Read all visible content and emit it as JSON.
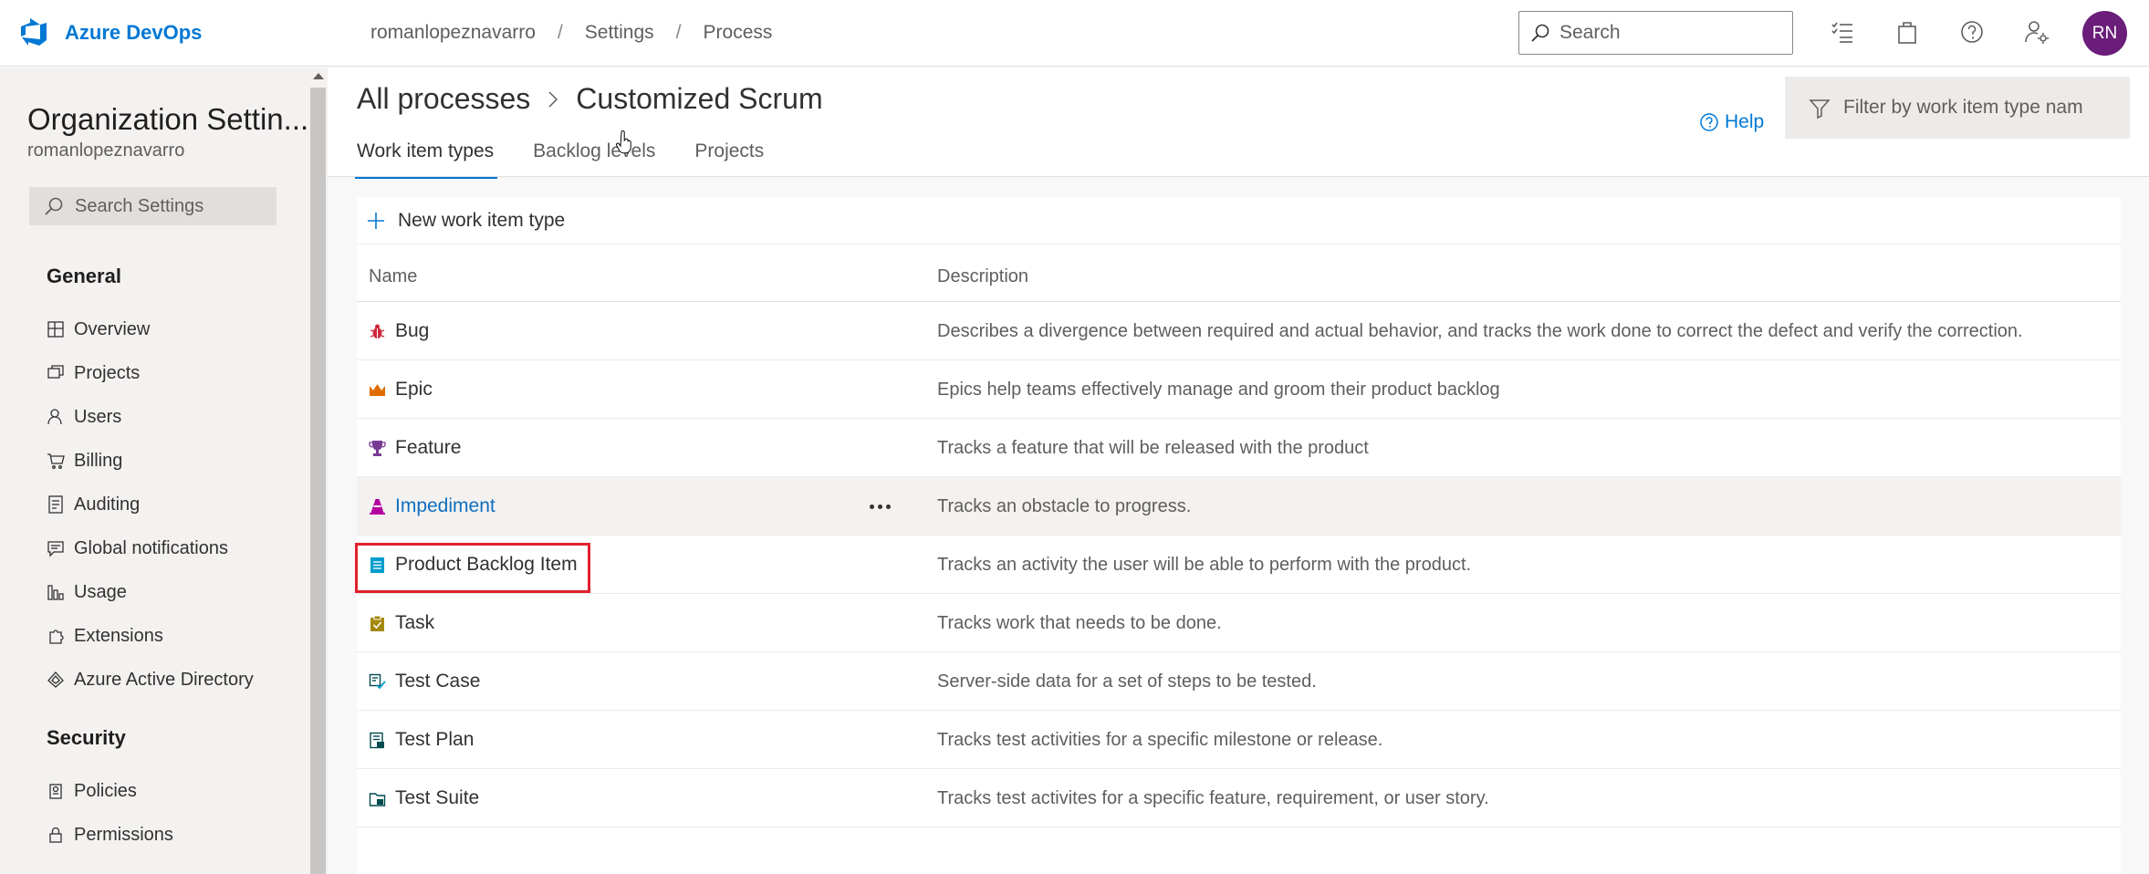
{
  "header": {
    "brand": "Azure DevOps",
    "breadcrumbs": [
      "romanlopeznavarro",
      "Settings",
      "Process"
    ],
    "search_placeholder": "Search",
    "avatar_initials": "RN",
    "icons": [
      "task-list-icon",
      "marketplace-bag-icon",
      "help-circle-icon",
      "user-settings-icon"
    ]
  },
  "sidebar": {
    "title": "Organization Settin...",
    "subtitle": "romanlopeznavarro",
    "search_placeholder": "Search Settings",
    "sections": [
      {
        "heading": "General",
        "items": [
          {
            "label": "Overview",
            "icon": "overview-icon"
          },
          {
            "label": "Projects",
            "icon": "projects-icon"
          },
          {
            "label": "Users",
            "icon": "users-icon"
          },
          {
            "label": "Billing",
            "icon": "billing-cart-icon"
          },
          {
            "label": "Auditing",
            "icon": "auditing-icon"
          },
          {
            "label": "Global notifications",
            "icon": "notifications-icon"
          },
          {
            "label": "Usage",
            "icon": "usage-chart-icon"
          },
          {
            "label": "Extensions",
            "icon": "extensions-icon"
          },
          {
            "label": "Azure Active Directory",
            "icon": "azure-ad-icon"
          }
        ]
      },
      {
        "heading": "Security",
        "items": [
          {
            "label": "Policies",
            "icon": "policies-icon"
          },
          {
            "label": "Permissions",
            "icon": "permissions-lock-icon"
          }
        ]
      }
    ]
  },
  "main": {
    "breadcrumb_root": "All processes",
    "process_name": "Customized Scrum",
    "help_label": "Help",
    "filter_placeholder": "Filter by work item type nam",
    "tabs": [
      {
        "label": "Work item types",
        "active": true
      },
      {
        "label": "Backlog levels",
        "active": false
      },
      {
        "label": "Projects",
        "active": false
      }
    ],
    "new_button_label": "New work item type",
    "columns": {
      "name": "Name",
      "description": "Description"
    },
    "work_item_types": [
      {
        "name": "Bug",
        "description": "Describes a divergence between required and actual behavior, and tracks the work done to correct the defect and verify the correction.",
        "icon": "bug-icon",
        "color": "#cc293d"
      },
      {
        "name": "Epic",
        "description": "Epics help teams effectively manage and groom their product backlog",
        "icon": "crown-icon",
        "color": "#e06c00"
      },
      {
        "name": "Feature",
        "description": "Tracks a feature that will be released with the product",
        "icon": "trophy-icon",
        "color": "#773b93"
      },
      {
        "name": "Impediment",
        "description": "Tracks an obstacle to progress.",
        "icon": "traffic-cone-icon",
        "color": "#b4009e",
        "hovered": true
      },
      {
        "name": "Product Backlog Item",
        "description": "Tracks an activity the user will be able to perform with the product.",
        "icon": "backlog-item-icon",
        "color": "#009ccc",
        "highlighted": true
      },
      {
        "name": "Task",
        "description": "Tracks work that needs to be done.",
        "icon": "clipboard-task-icon",
        "color": "#a4880a"
      },
      {
        "name": "Test Case",
        "description": "Server-side data for a set of steps to be tested.",
        "icon": "test-case-icon",
        "color": "#004b50"
      },
      {
        "name": "Test Plan",
        "description": "Tracks test activities for a specific milestone or release.",
        "icon": "test-plan-icon",
        "color": "#004b50"
      },
      {
        "name": "Test Suite",
        "description": "Tracks test activites for a specific feature, requirement, or user story.",
        "icon": "test-suite-icon",
        "color": "#004b50"
      }
    ]
  },
  "colors": {
    "accent": "#0078d4",
    "avatar": "#6b1d7a",
    "highlight_border": "#e0202e"
  }
}
